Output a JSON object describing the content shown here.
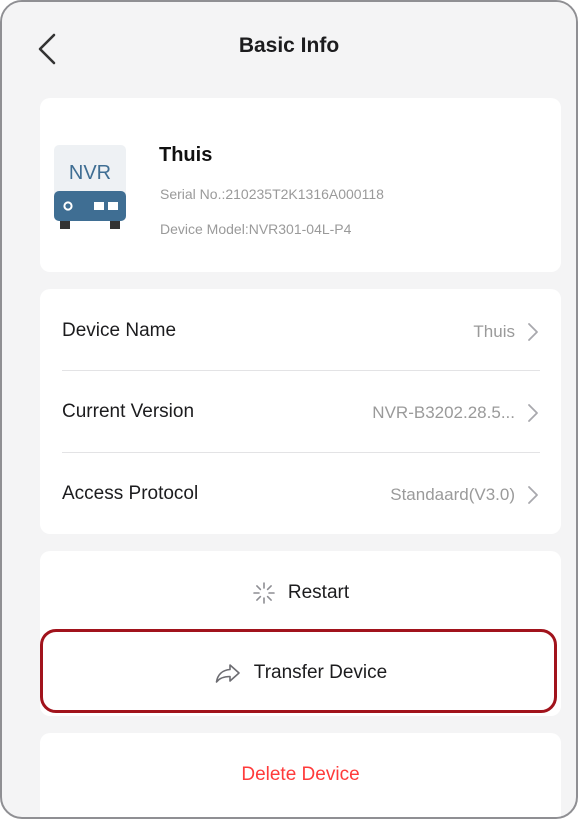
{
  "header": {
    "title": "Basic Info",
    "back_icon": "chevron-left-icon"
  },
  "device": {
    "icon_label": "NVR",
    "name": "Thuis",
    "serial": "Serial No.:210235T2K1316A000118",
    "model": "Device Model:NVR301-04L-P4"
  },
  "settings": [
    {
      "label": "Device Name",
      "value": "Thuis"
    },
    {
      "label": "Current Version",
      "value": "NVR-B3202.28.5..."
    },
    {
      "label": "Access Protocol",
      "value": "Standaard(V3.0)"
    }
  ],
  "actions": {
    "restart": "Restart",
    "transfer": "Transfer Device",
    "delete": "Delete Device"
  },
  "colors": {
    "background": "#f4f4f5",
    "card": "#ffffff",
    "delete": "#ff3b3b",
    "highlight": "#a1131c",
    "nvr_icon": "#3f6e93"
  }
}
